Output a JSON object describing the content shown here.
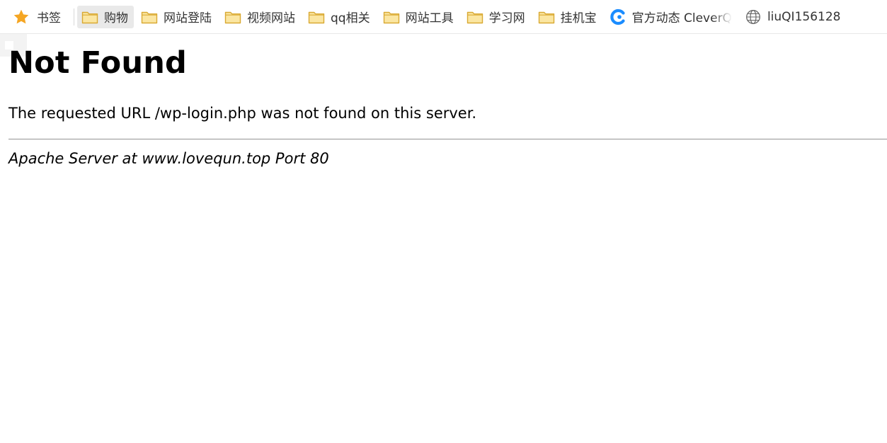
{
  "bookmarks_bar": {
    "root": {
      "label": "书签",
      "icon": "star-icon",
      "color": "#f5a623"
    },
    "items": [
      {
        "label": "购物",
        "icon": "folder-icon",
        "active": true
      },
      {
        "label": "网站登陆",
        "icon": "folder-icon"
      },
      {
        "label": "视频网站",
        "icon": "folder-icon"
      },
      {
        "label": "qq相关",
        "icon": "folder-icon"
      },
      {
        "label": "网站工具",
        "icon": "folder-icon"
      },
      {
        "label": "学习网",
        "icon": "folder-icon"
      },
      {
        "label": "挂机宝",
        "icon": "folder-icon"
      },
      {
        "label": "官方动态 CleverQ",
        "icon": "cleverq-logo-icon",
        "color": "#1a8cff"
      },
      {
        "label": "liuQI156128",
        "icon": "globe-icon"
      }
    ],
    "folder_color": "#f8d775"
  },
  "page": {
    "title": "Not Found",
    "message": "The requested URL /wp-login.php was not found on this server.",
    "server_signature": "Apache Server at www.lovequn.top Port 80"
  }
}
